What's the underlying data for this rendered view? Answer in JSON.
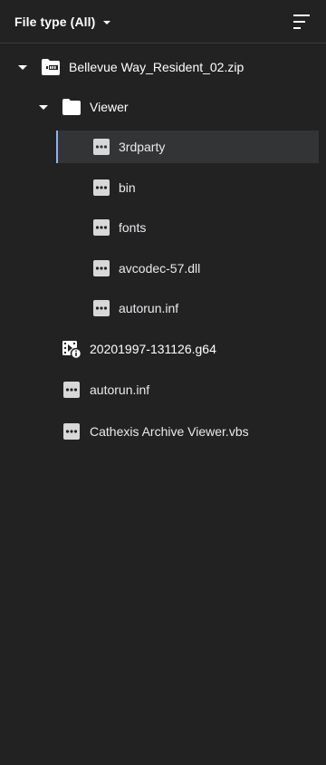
{
  "header": {
    "filter_label": "File type (All)"
  },
  "tree": {
    "root": {
      "label": "Bellevue Way_Resident_02.zip",
      "expanded": true
    },
    "viewer_folder": {
      "label": "Viewer",
      "expanded": true
    },
    "viewer_children": [
      {
        "label": "3rdparty",
        "selected": true
      },
      {
        "label": "bin"
      },
      {
        "label": "fonts"
      },
      {
        "label": "avcodec-57.dll"
      },
      {
        "label": "autorun.inf"
      }
    ],
    "root_children": [
      {
        "label": "20201997-131126.g64"
      },
      {
        "label": "autorun.inf"
      },
      {
        "label": "Cathexis Archive Viewer.vbs"
      }
    ]
  },
  "colors": {
    "background": "#222223",
    "selected_row": "#333435",
    "selection_accent": "#8ab4f8",
    "icon": "#d8d8d8"
  }
}
